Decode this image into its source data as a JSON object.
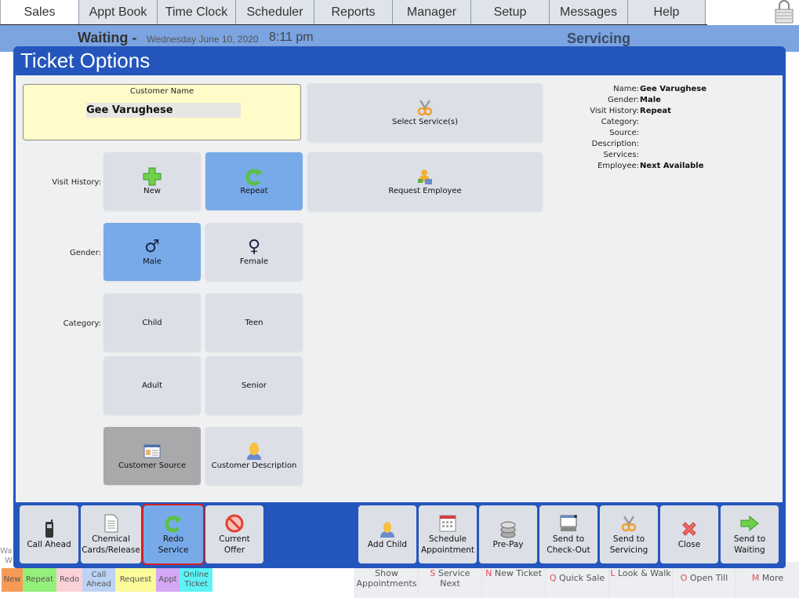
{
  "nav": {
    "tabs": [
      "Sales",
      "Appt Book",
      "Time Clock",
      "Scheduler",
      "Reports",
      "Manager",
      "Setup",
      "Messages",
      "Help"
    ],
    "active_tab": "Sales",
    "lock_icon": "lock-icon"
  },
  "status_band": {
    "waiting_label": "Waiting -",
    "date": "Wednesday June 10, 2020",
    "time": "8:11 pm",
    "servicing_label": "Servicing"
  },
  "background": {
    "left_truncated": [
      "Wa",
      "W"
    ],
    "legend": [
      {
        "label": "New",
        "color": "#f79a55"
      },
      {
        "label": "Repeat",
        "color": "#93f07a"
      },
      {
        "label": "Redo",
        "color": "#fbd1d8"
      },
      {
        "label": "Call Ahead",
        "color": "#bcd3f3"
      },
      {
        "label": "Request",
        "color": "#fbfb9a"
      },
      {
        "label": "Appt",
        "color": "#d4a8f4"
      },
      {
        "label": "Online Ticket",
        "color": "#5cf3f6"
      }
    ],
    "bottom_row": [
      {
        "key": "",
        "label": "Show Appointments"
      },
      {
        "key": "S",
        "label": "Service Next"
      },
      {
        "key": "N",
        "label": "New Ticket"
      },
      {
        "key": "Q",
        "label": "Quick Sale"
      },
      {
        "key": "L",
        "label": "Look & Walk"
      },
      {
        "key": "O",
        "label": "Open Till"
      },
      {
        "key": "M",
        "label": "More"
      }
    ]
  },
  "modal": {
    "title": "Ticket Options",
    "customer": {
      "label": "Customer Name",
      "value": "Gee Varughese"
    },
    "select_services": "Select Service(s)",
    "request_employee": "Request Employee",
    "visit_history": {
      "label": "Visit History:",
      "options": [
        "New",
        "Repeat"
      ],
      "selected": "Repeat"
    },
    "gender": {
      "label": "Gender:",
      "options": [
        "Male",
        "Female"
      ],
      "selected": "Male"
    },
    "category": {
      "label": "Category:",
      "options": [
        "Child",
        "Teen",
        "Adult",
        "Senior"
      ],
      "selected": ""
    },
    "customer_source": "Customer Source",
    "customer_description": "Customer Description",
    "summary": [
      {
        "key": "Name:",
        "value": "Gee Varughese"
      },
      {
        "key": "Gender:",
        "value": "Male"
      },
      {
        "key": "Visit History:",
        "value": "Repeat"
      },
      {
        "key": "Category:",
        "value": ""
      },
      {
        "key": "Source:",
        "value": ""
      },
      {
        "key": "Description:",
        "value": ""
      },
      {
        "key": "Services:",
        "value": ""
      },
      {
        "key": "Employee:",
        "value": "Next Available"
      }
    ],
    "toolbar": {
      "call_ahead": "Call Ahead",
      "chemical_1": "Chemical",
      "chemical_2": "Cards/Release",
      "redo_1": "Redo",
      "redo_2": "Service",
      "offer_1": "Current",
      "offer_2": "Offer",
      "add_child": "Add Child",
      "schedule_1": "Schedule",
      "schedule_2": "Appointment",
      "prepay": "Pre-Pay",
      "checkout_1": "Send to",
      "checkout_2": "Check-Out",
      "servicing_1": "Send to",
      "servicing_2": "Servicing",
      "close": "Close",
      "waiting_1": "Send to",
      "waiting_2": "Waiting"
    }
  },
  "colors": {
    "modal_blue": "#2456bd",
    "selected_button": "#78aaea",
    "status_band": "#7ba4e0",
    "highlight_border": "#d42020"
  }
}
